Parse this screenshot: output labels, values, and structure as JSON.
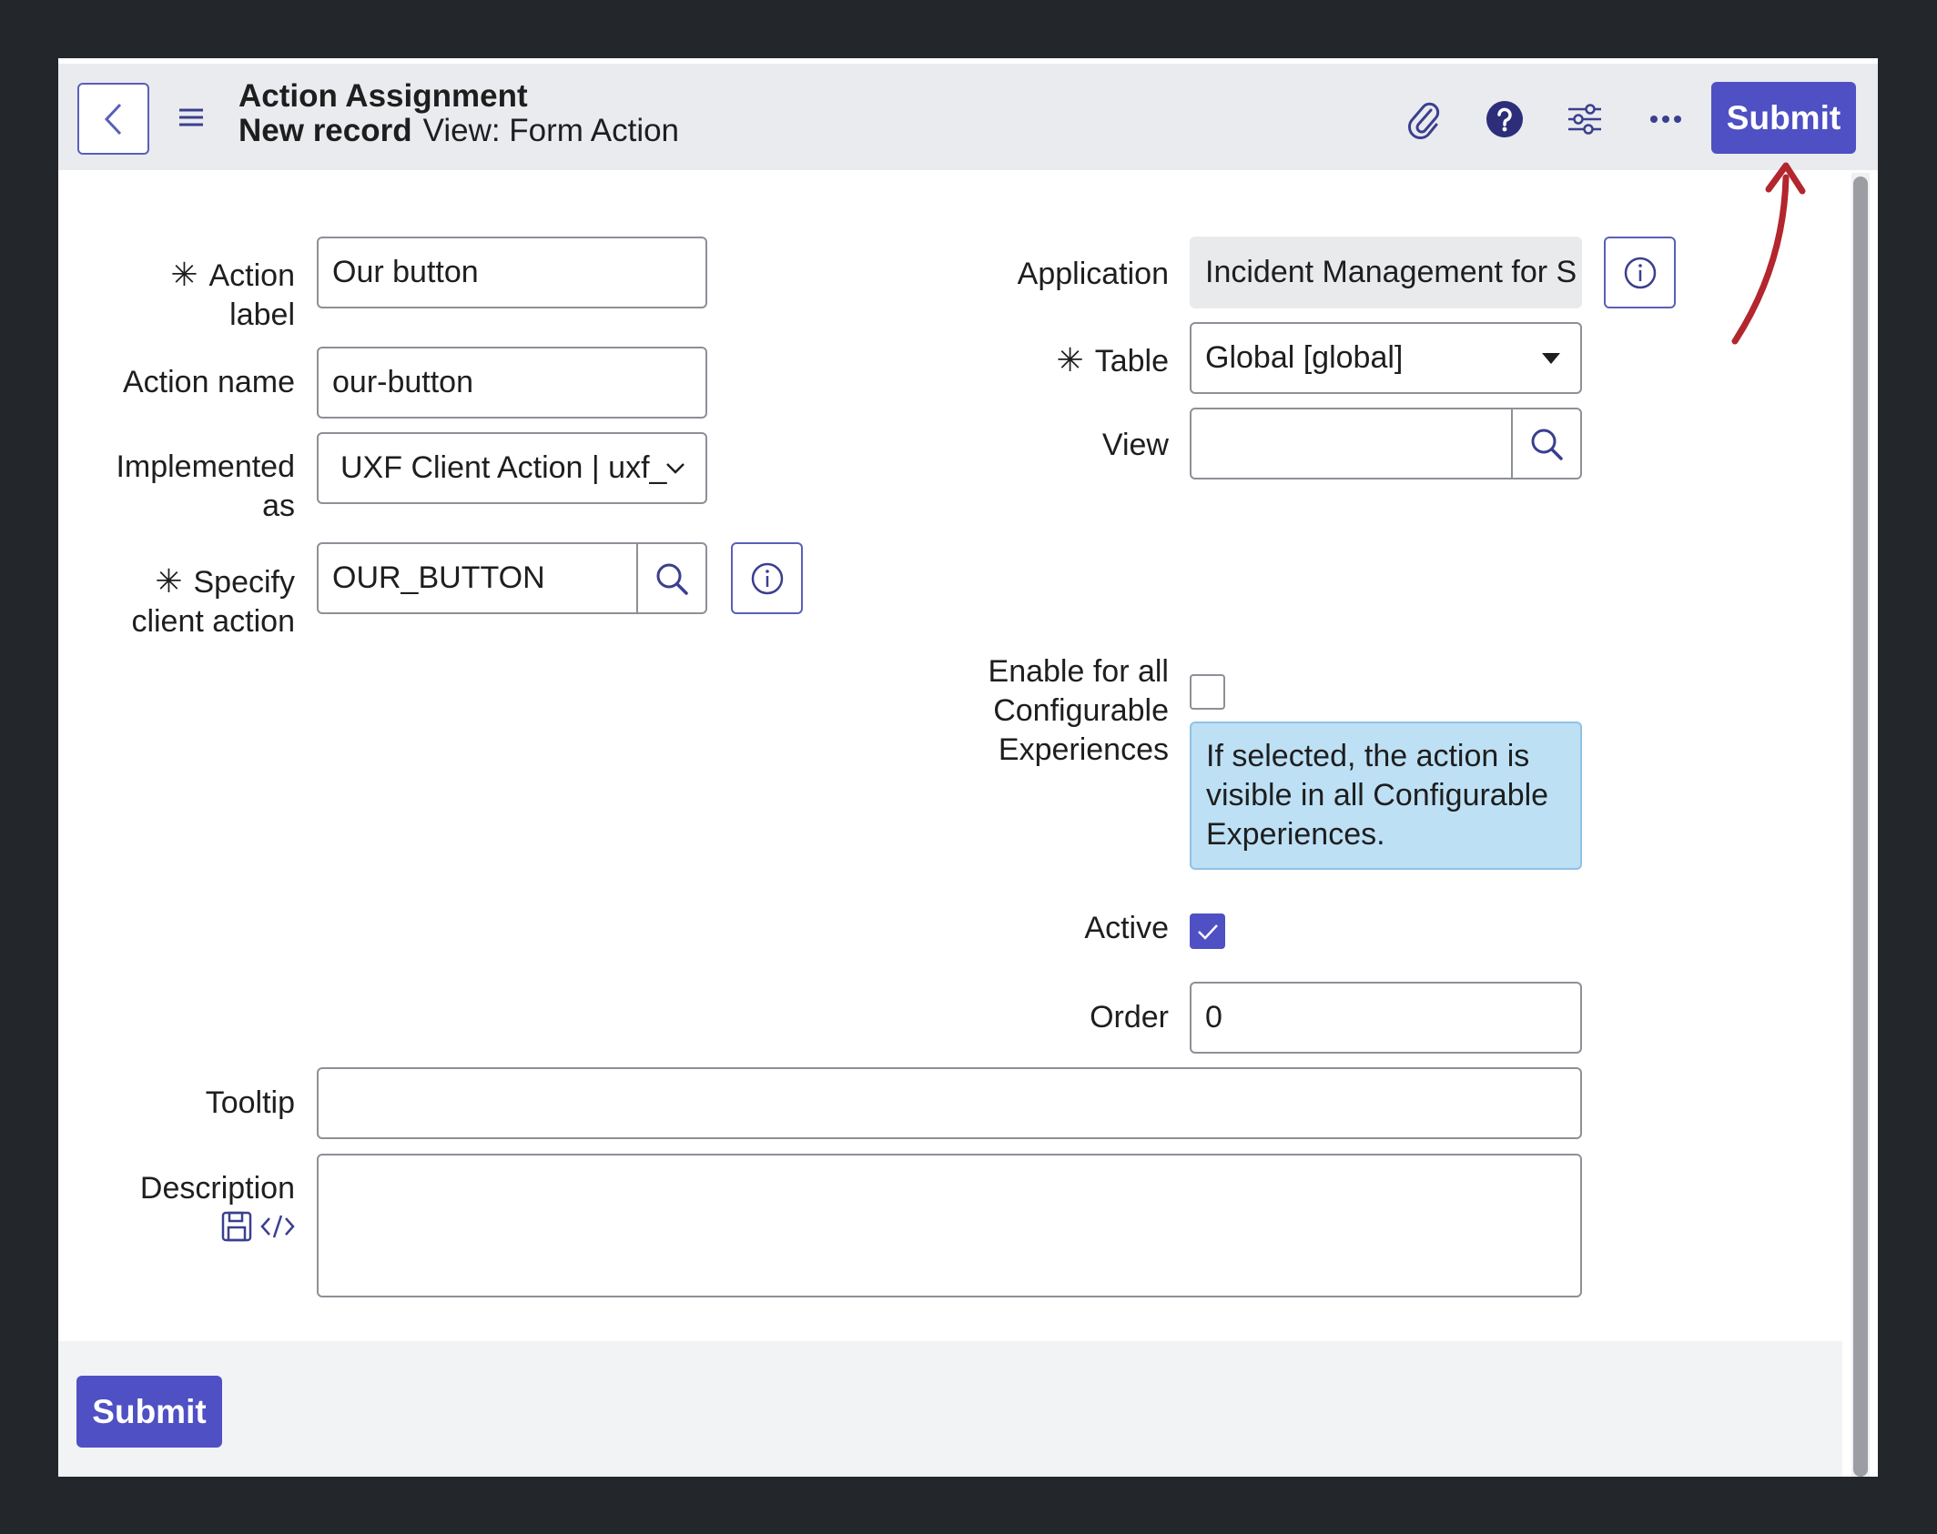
{
  "header": {
    "title": "Action Assignment",
    "record": "New record",
    "view": "View: Form Action",
    "submit_label": "Submit"
  },
  "form": {
    "action_label": {
      "label_line1": "Action",
      "label_line2": "label",
      "value": "Our button"
    },
    "action_name": {
      "label": "Action name",
      "value": "our-button"
    },
    "implemented_as": {
      "label_line1": "Implemented",
      "label_line2": "as",
      "value": "UXF Client Action | uxf_"
    },
    "specify_client_action": {
      "label_line1": "Specify",
      "label_line2": "client action",
      "value": "OUR_BUTTON"
    },
    "application": {
      "label": "Application",
      "value": "Incident Management for S"
    },
    "table": {
      "label": "Table",
      "value": "Global [global]"
    },
    "view": {
      "label": "View",
      "value": ""
    },
    "enable_all": {
      "label_line1": "Enable for all",
      "label_line2": "Configurable",
      "label_line3": "Experiences",
      "checked": false,
      "hint": "If selected, the action is visible in all Configurable Experiences."
    },
    "active": {
      "label": "Active",
      "checked": true
    },
    "order": {
      "label": "Order",
      "value": "0"
    },
    "tooltip": {
      "label": "Tooltip",
      "value": ""
    },
    "description": {
      "label": "Description",
      "value": ""
    }
  },
  "footer": {
    "submit_label": "Submit"
  },
  "icons": {
    "back": "chevron-left-icon",
    "menu": "hamburger-icon",
    "attach": "paperclip-icon",
    "help": "help-icon",
    "settings": "sliders-icon",
    "more": "more-icon",
    "search": "search-icon",
    "info": "info-icon",
    "save": "save-icon",
    "code": "code-icon"
  },
  "colors": {
    "accent": "#4f50c4",
    "hint_bg": "#bde0f5",
    "annotation": "#b3262d"
  }
}
